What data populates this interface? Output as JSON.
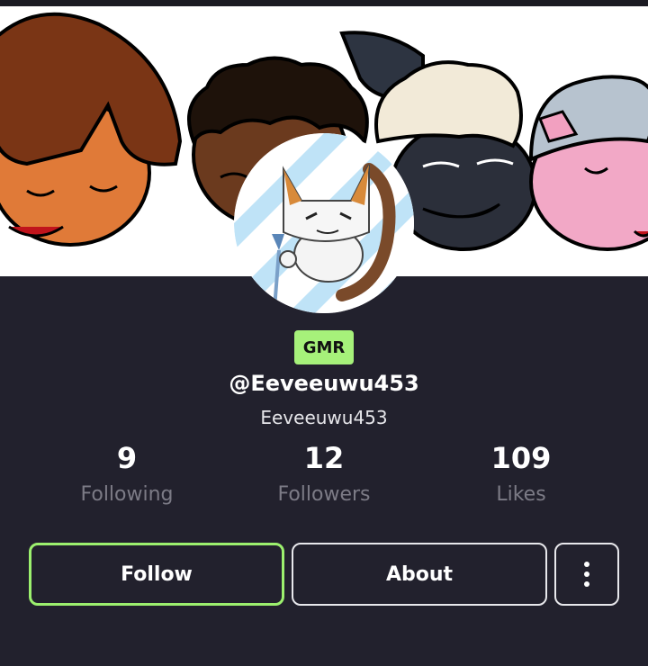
{
  "profile": {
    "badge": "GMR",
    "handle": "@Eeveeuwu453",
    "username": "Eeveeuwu453"
  },
  "stats": [
    {
      "value": "9",
      "label": "Following"
    },
    {
      "value": "12",
      "label": "Followers"
    },
    {
      "value": "109",
      "label": "Likes"
    }
  ],
  "actions": {
    "follow_label": "Follow",
    "about_label": "About",
    "more_icon": "more-vertical-icon"
  },
  "colors": {
    "background": "#22212d",
    "badge": "#a6f17a",
    "follow_border": "#9cf06e",
    "muted_text": "#7c7b86"
  }
}
